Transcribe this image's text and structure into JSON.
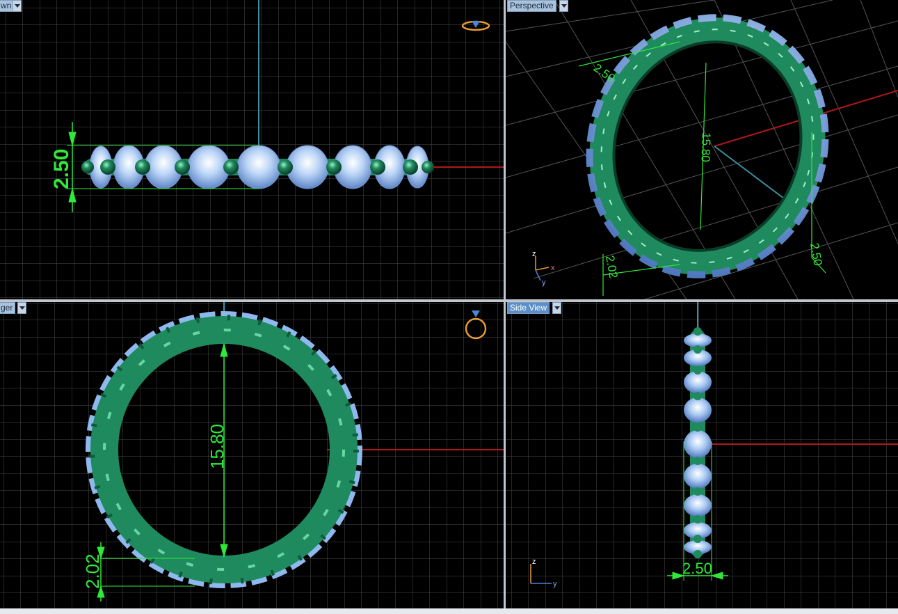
{
  "viewports": {
    "top_left": {
      "label": "wn"
    },
    "top_right": {
      "label": "Perspective"
    },
    "bottom_left": {
      "label": "ger"
    },
    "bottom_right": {
      "label": "Side View"
    }
  },
  "dimensions": {
    "height_front": "2.50",
    "diameter": "15.80",
    "band_width": "2.02",
    "persp_width": "2.50",
    "persp_diameter": "15.80",
    "persp_band": "2.02",
    "persp_height": "2.50",
    "side_width": "2.50"
  },
  "axis_labels": {
    "z": "z",
    "x": "x",
    "y": "y"
  },
  "colors": {
    "grid": "#4c4c4c",
    "metal": "#1f8a5e",
    "stone": "#8fb8ee",
    "dimension": "#2fe83a",
    "axis_x": "#b0171b",
    "axis_y": "#3a8fa0",
    "active_tab": "#5b8fc9"
  }
}
